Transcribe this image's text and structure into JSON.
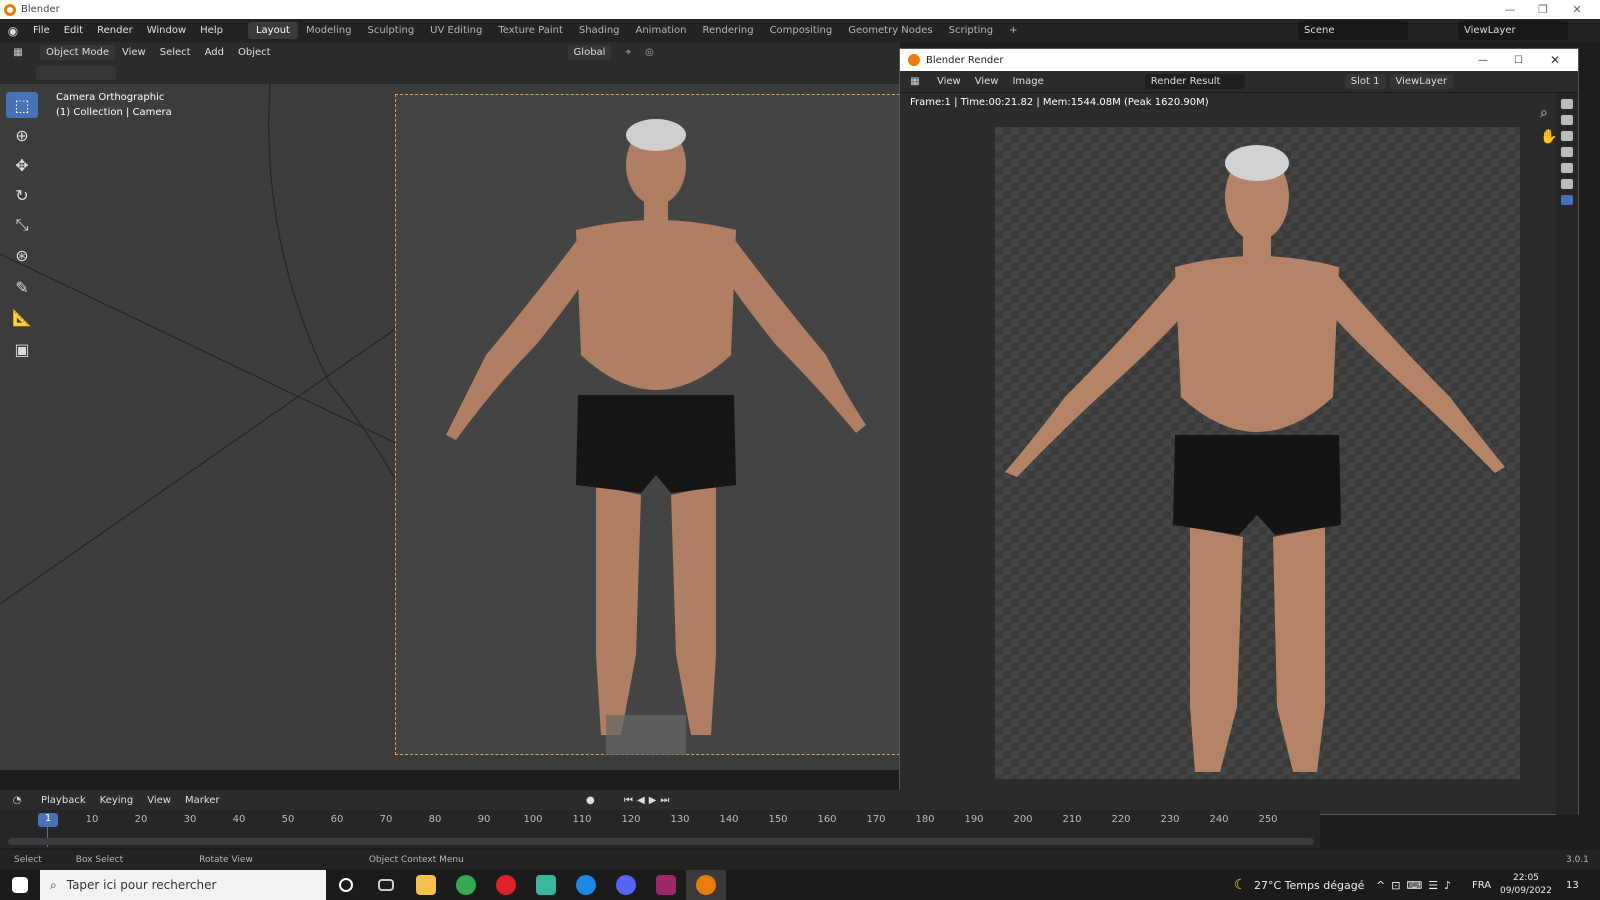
{
  "app": {
    "title": "Blender"
  },
  "menu": [
    "File",
    "Edit",
    "Render",
    "Window",
    "Help"
  ],
  "workspaces": [
    "Layout",
    "Modeling",
    "Sculpting",
    "UV Editing",
    "Texture Paint",
    "Shading",
    "Animation",
    "Rendering",
    "Compositing",
    "Geometry Nodes",
    "Scripting"
  ],
  "scene": {
    "name": "Scene",
    "view_layer": "ViewLayer"
  },
  "viewport_header": {
    "mode": "Object Mode",
    "items": [
      "View",
      "Select",
      "Add",
      "Object"
    ],
    "transform": "Global"
  },
  "viewport": {
    "camera_label": "Camera Orthographic",
    "collection_label": "(1) Collection | Camera"
  },
  "render_window": {
    "title": "Blender Render",
    "menu": [
      "View",
      "View",
      "Image"
    ],
    "image_name": "Render Result",
    "slot": "Slot 1",
    "view_layer": "ViewLayer",
    "info": "Frame:1 | Time:00:21.82 | Mem:1544.08M (Peak 1620.90M)"
  },
  "timeline": {
    "menu": [
      "Playback",
      "Keying",
      "View",
      "Marker"
    ],
    "current_frame": "1",
    "ticks": [
      "10",
      "20",
      "30",
      "40",
      "50",
      "60",
      "70",
      "80",
      "90",
      "100",
      "110",
      "120",
      "130",
      "140",
      "150",
      "160",
      "170",
      "180",
      "190",
      "200",
      "210",
      "220",
      "230",
      "240",
      "250"
    ]
  },
  "status_bar": {
    "items": [
      "Select",
      "Box Select",
      "Rotate View",
      "Object Context Menu"
    ],
    "version": "3.0.1"
  },
  "taskbar": {
    "search_placeholder": "Taper ici pour rechercher",
    "weather": "27°C  Temps dégagé",
    "language": "FRA",
    "time": "22:05",
    "date": "09/09/2022",
    "notifications": "13"
  },
  "colors": {
    "accent": "#4772b3",
    "camera_frame": "#e2a04a",
    "blender_orange": "#e87d0d"
  }
}
